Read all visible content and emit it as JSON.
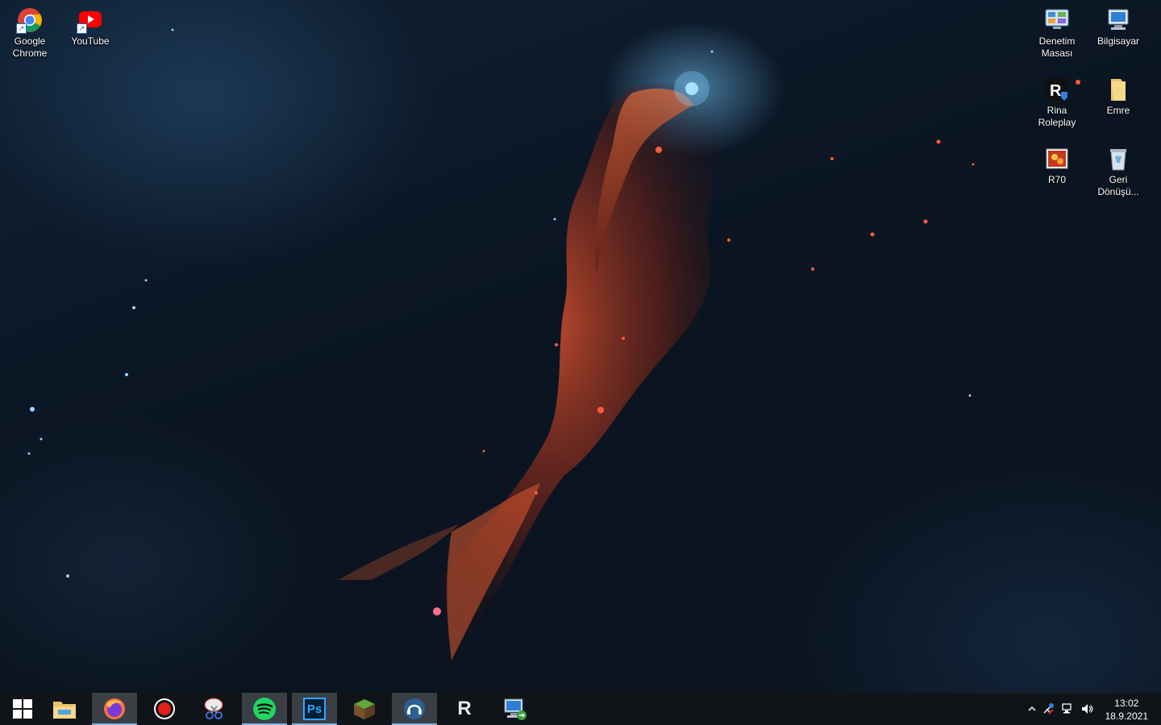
{
  "desktop": {
    "icons_left": [
      {
        "label": "Google\nChrome",
        "icon": "chrome-icon"
      },
      {
        "label": "YouTube",
        "icon": "youtube-icon"
      }
    ],
    "icons_right": [
      {
        "label": "Denetim\nMasası",
        "icon": "control-panel-icon"
      },
      {
        "label": "Bilgisayar",
        "icon": "computer-icon"
      },
      {
        "label": "Rina Roleplay",
        "icon": "rina-roleplay-icon"
      },
      {
        "label": "Emre",
        "icon": "folder-icon"
      },
      {
        "label": "R70",
        "icon": "r70-image-icon"
      },
      {
        "label": "Geri\nDönüşü...",
        "icon": "recycle-bin-icon"
      }
    ]
  },
  "taskbar": {
    "apps": [
      {
        "name": "start",
        "icon": "windows-start-icon"
      },
      {
        "name": "file-explorer",
        "icon": "file-explorer-icon"
      },
      {
        "name": "firefox",
        "icon": "firefox-icon",
        "running": true
      },
      {
        "name": "recorder",
        "icon": "record-icon"
      },
      {
        "name": "snipping-tool",
        "icon": "snipping-tool-icon"
      },
      {
        "name": "spotify",
        "icon": "spotify-icon",
        "running": true
      },
      {
        "name": "photoshop",
        "icon": "photoshop-icon",
        "running": true
      },
      {
        "name": "minecraft",
        "icon": "minecraft-icon"
      },
      {
        "name": "teamspeak",
        "icon": "teamspeak-icon",
        "running": true
      },
      {
        "name": "rina",
        "icon": "rina-icon"
      },
      {
        "name": "remote-desktop",
        "icon": "remote-desktop-icon"
      }
    ],
    "ps_label": "Ps",
    "rina_label": "R",
    "clock": {
      "time": "13:02",
      "date": "18.9.2021"
    },
    "tray_icons": [
      "chevron-up-icon",
      "bluetooth-icon",
      "network-icon",
      "volume-icon"
    ]
  },
  "colors": {
    "taskbar_bg": "#101418",
    "running_bg": "#3a3f45",
    "accent": "#7fb0e0"
  }
}
